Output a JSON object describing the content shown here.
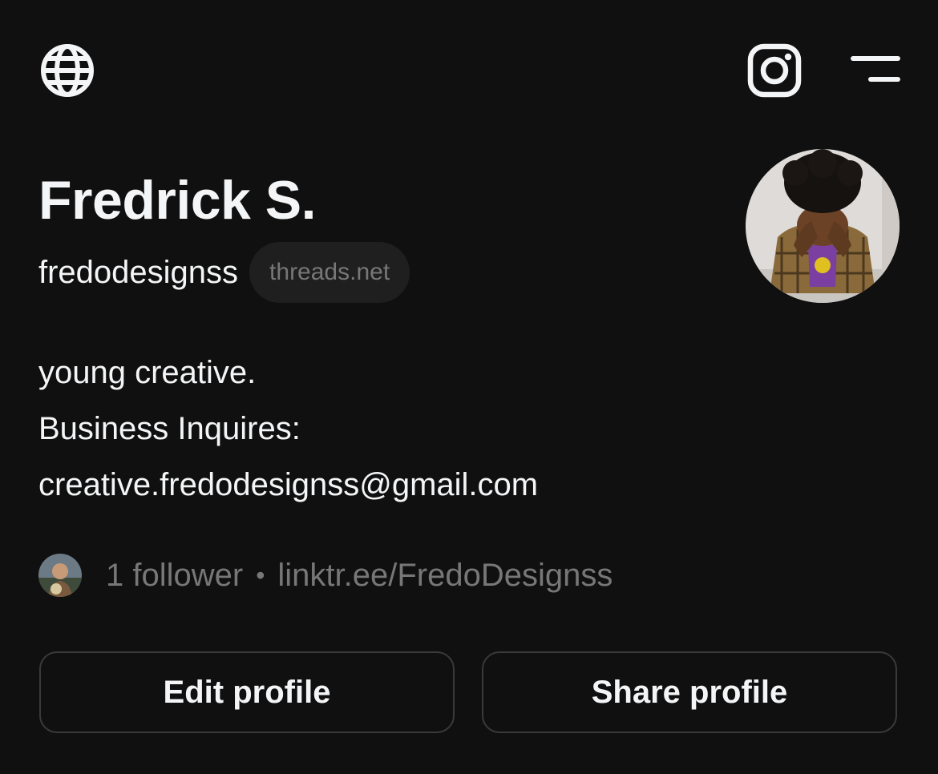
{
  "header": {
    "left_icon": "globe-icon",
    "right_icons": [
      "instagram-icon",
      "menu-icon"
    ]
  },
  "profile": {
    "name": "Fredrick S.",
    "handle": "fredodesignss",
    "domain_badge": "threads.net",
    "bio": [
      "young creative.",
      "Business Inquires:",
      "creative.fredodesignss@gmail.com"
    ],
    "followers": "1 follower",
    "separator": "•",
    "link": "linktr.ee/FredoDesignss"
  },
  "actions": {
    "edit_label": "Edit profile",
    "share_label": "Share profile"
  },
  "colors": {
    "background": "#101010",
    "text_primary": "#f3f5f7",
    "text_secondary": "#777777",
    "border": "#3a3a3a",
    "pill_bg": "#1f1f1f"
  }
}
